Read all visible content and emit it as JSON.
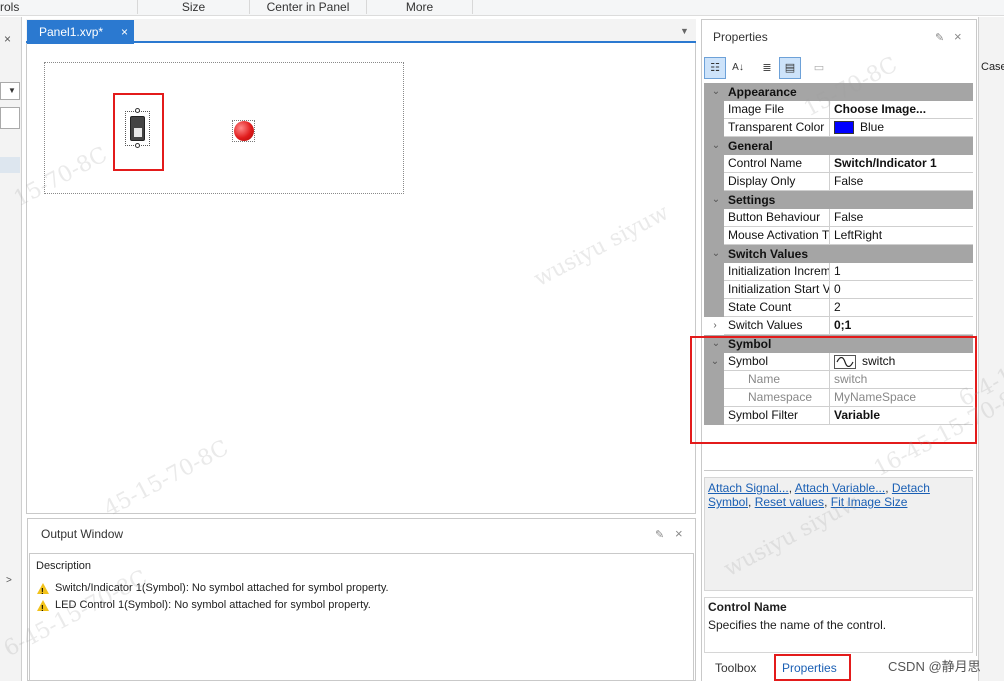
{
  "ribbon": {
    "left_fragment": "rols",
    "labels": [
      "Size",
      "Center in Panel",
      "More"
    ]
  },
  "document": {
    "tab_title": "Panel1.xvp*",
    "tab_close": "×",
    "overflow_glyph": "▼"
  },
  "output": {
    "title": "Output Window",
    "column_header": "Description",
    "rows": [
      {
        "text": "Switch/Indicator 1(Symbol): No symbol attached for symbol property."
      },
      {
        "text": "LED Control 1(Symbol): No symbol attached for symbol property."
      }
    ]
  },
  "properties": {
    "title": "Properties",
    "categories": {
      "appearance": "Appearance",
      "general": "General",
      "settings": "Settings",
      "switch_values": "Switch Values",
      "symbol": "Symbol"
    },
    "rows": {
      "image_file": {
        "name": "Image File",
        "value": "Choose Image..."
      },
      "transparent_color": {
        "name": "Transparent Color",
        "value": "Blue",
        "swatch": "#0000ff"
      },
      "control_name": {
        "name": "Control Name",
        "value": "Switch/Indicator 1"
      },
      "display_only": {
        "name": "Display Only",
        "value": "False"
      },
      "button_behaviour": {
        "name": "Button Behaviour",
        "value": "False"
      },
      "mouse_activation": {
        "name": "Mouse Activation T",
        "value": "LeftRight"
      },
      "init_increment": {
        "name": "Initialization Increm",
        "value": "1"
      },
      "init_start": {
        "name": "Initialization Start V",
        "value": "0"
      },
      "state_count": {
        "name": "State Count",
        "value": "2"
      },
      "switch_values": {
        "name": "Switch Values",
        "value": "0;1"
      },
      "symbol": {
        "name": "Symbol",
        "value": "switch"
      },
      "sym_name": {
        "name": "Name",
        "value": "switch"
      },
      "sym_namespace": {
        "name": "Namespace",
        "value": "MyNameSpace"
      },
      "symbol_filter": {
        "name": "Symbol Filter",
        "value": "Variable"
      }
    },
    "commands": {
      "attach_signal": "Attach Signal...",
      "attach_variable": "Attach Variable...",
      "detach_symbol": "Detach Symbol",
      "reset_values": "Reset values",
      "fit_image_size": "Fit Image Size"
    },
    "description": {
      "title": "Control Name",
      "text": "Specifies the name of the control."
    },
    "bottom_tabs": {
      "toolbox": "Toolbox",
      "properties": "Properties"
    }
  },
  "right_edge": {
    "label": "Case"
  },
  "watermarks": {
    "a": "15-70-8C",
    "b": "wusiyu  siyuw",
    "c": "45-15-70-8C",
    "d": "wusiyu  siyuw",
    "e": "15-70-8C",
    "f": "6-45-15-70-8C",
    "g": "6-4-1",
    "h": "16-45-15-70-8C"
  },
  "csdn": "CSDN @静月思",
  "colors": {
    "accent": "#2b79d0",
    "highlight_red": "#e31b1b",
    "link": "#1a5fb4",
    "category_bg": "#a5a5a5",
    "led_red": "#e01b1b"
  }
}
